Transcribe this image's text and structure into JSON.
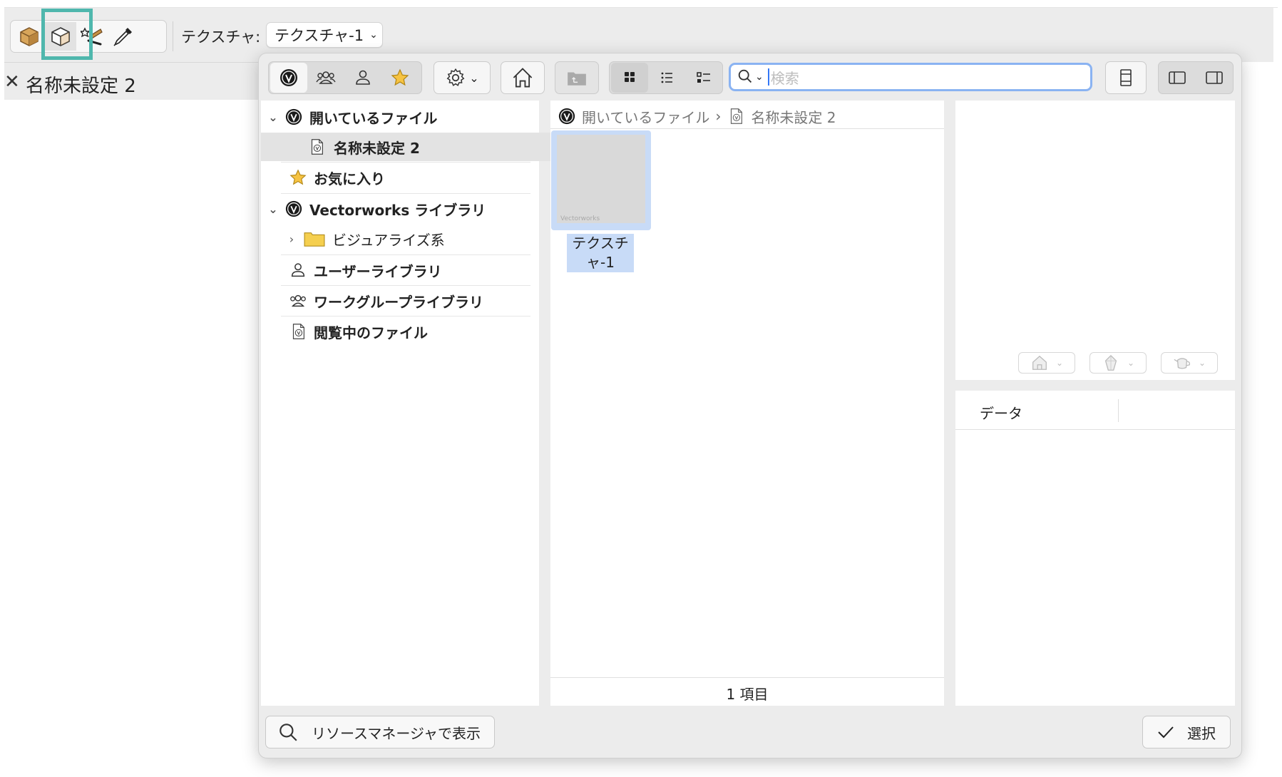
{
  "toolbar": {
    "tools": [
      {
        "name": "texture-box-tool",
        "icon": "solid-box-icon"
      },
      {
        "name": "texture-cube-tool",
        "icon": "open-cube-icon"
      },
      {
        "name": "texture-wand-tool",
        "icon": "magic-wand-icon"
      },
      {
        "name": "eyedropper-tool",
        "icon": "eyedropper-icon"
      }
    ],
    "texture_label": "テクスチャ:",
    "texture_value": "テクスチャ-1"
  },
  "doc_tab": {
    "close_glyph": "✕",
    "title": "名称未設定 2"
  },
  "popup": {
    "search_placeholder": "検索",
    "tree": {
      "open_files": "開いているファイル",
      "current_file": "名称未設定 2",
      "favorites": "お気に入り",
      "vectorworks_library": "Vectorworks ライブラリ",
      "visualize_folder": "ビジュアライズ系",
      "user_library": "ユーザーライブラリ",
      "workgroup_library": "ワークグループライブラリ",
      "browsing_files": "閲覧中のファイル"
    },
    "breadcrumb": {
      "root": "開いているファイル",
      "sep": "›",
      "file": "名称未設定 2"
    },
    "items": [
      {
        "label": "テクスチャ-1",
        "watermark": "Vectorworks"
      }
    ],
    "status": "1 項目",
    "data_label": "データ",
    "show_in_rm_label": "リソースマネージャで表示",
    "select_label": "選択"
  }
}
